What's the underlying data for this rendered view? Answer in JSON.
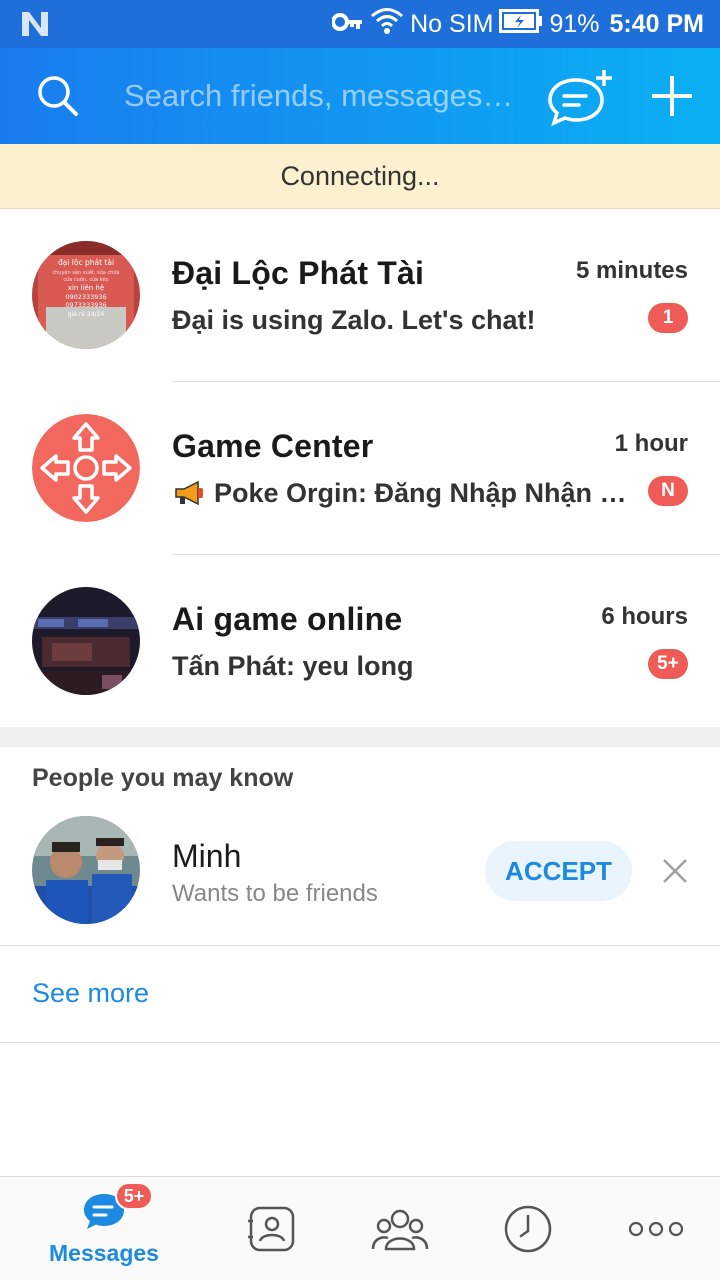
{
  "status_bar": {
    "carrier": "No SIM",
    "battery": "91%",
    "time": "5:40 PM"
  },
  "header": {
    "search_placeholder": "Search friends, messages…"
  },
  "banner": {
    "text": "Connecting..."
  },
  "conversations": [
    {
      "name": "Đại Lộc Phát Tài",
      "time": "5 minutes",
      "preview": "Đại is using Zalo. Let's chat!",
      "badge": "1"
    },
    {
      "name": "Game Center",
      "time": "1 hour",
      "preview": "Poke Orgin: Đăng Nhập Nhận Nhiều Quà",
      "badge": "N"
    },
    {
      "name": "Ai game online",
      "time": "6 hours",
      "preview": "Tấn Phát: yeu long",
      "badge": "5+"
    }
  ],
  "avatar_texts": {
    "dailoc_title": "đại lộc phát tài",
    "dailoc_line1": "chuyên sản xuất, sửa chữa",
    "dailoc_line2": "cửa cuốn, cửa kéo",
    "dailoc_line3": "xin liên hệ",
    "dailoc_phone1": "0902333936",
    "dailoc_phone2": "0973333936",
    "dailoc_price": "giá rẻ 24/24"
  },
  "people_you_may_know": {
    "title": "People you may know",
    "person": {
      "name": "Minh",
      "subtitle": "Wants to be friends",
      "accept_label": "ACCEPT"
    },
    "see_more": "See more"
  },
  "bottom_nav": {
    "messages_label": "Messages",
    "messages_badge": "5+"
  },
  "colors": {
    "header_start": "#1a7cf0",
    "header_end": "#0ab0f3",
    "badge": "#ef5b57",
    "accent": "#1b8ae0",
    "banner": "#fcf1cf"
  },
  "icons": {
    "status": [
      "n-logo-icon",
      "vpn-key-icon",
      "wifi-icon",
      "battery-icon"
    ],
    "header": [
      "search-icon",
      "new-chat-icon",
      "plus-icon"
    ],
    "nav": [
      "messages-icon",
      "contacts-icon",
      "groups-icon",
      "timeline-clock-icon",
      "more-dots-icon"
    ]
  }
}
